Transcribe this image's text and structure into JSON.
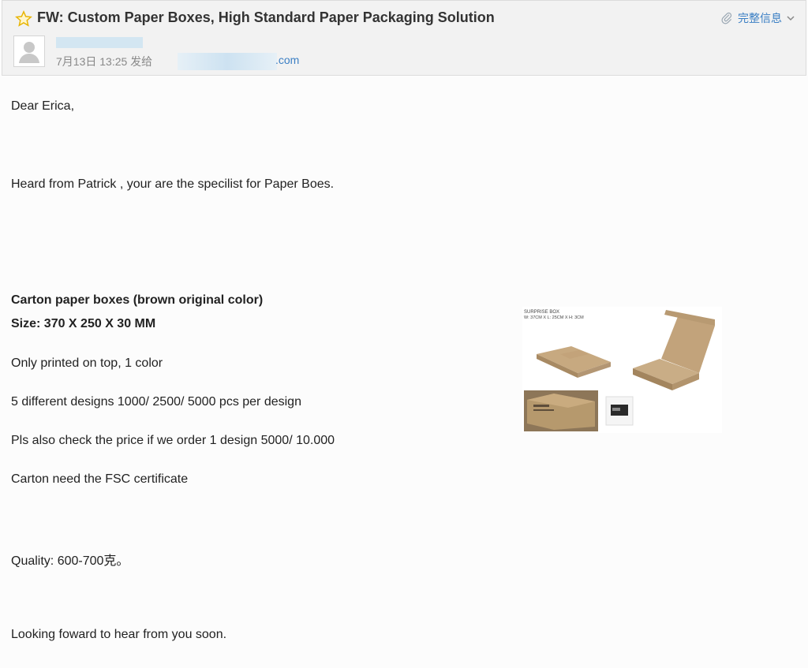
{
  "header": {
    "subject": "FW: Custom Paper Boxes, High Standard Paper Packaging Solution",
    "full_info_label": "完整信息",
    "date_text": "7月13日 13:25 发给",
    "address_suffix": ".com"
  },
  "icons": {
    "star": "star-outline-icon",
    "attachment": "paperclip-icon",
    "expand": "chevron-down-icon",
    "avatar": "default-user-avatar"
  },
  "colors": {
    "link": "#3b7fc4",
    "star": "#e8b400"
  },
  "body": {
    "greeting": "Dear Erica,",
    "intro": "Heard from Patrick , your are the specilist for Paper Boes.",
    "product_title": "Carton paper boxes (brown original color)",
    "size": "Size: 370 X 250 X 30 MM",
    "printing": "Only printed on top, 1 color",
    "designs": "5 different designs 1000/ 2500/ 5000 pcs per design",
    "price_check": "Pls also check the price if we order 1 design 5000/ 10.000",
    "certificate": "Carton need the FSC certificate",
    "quality": "Quality: 600-700克。",
    "closing": "Looking foward to hear from you soon."
  },
  "image": {
    "caption_title": "SURPRISE BOX",
    "caption_dims": "W: 37CM X L: 25CM X H: 3CM"
  }
}
